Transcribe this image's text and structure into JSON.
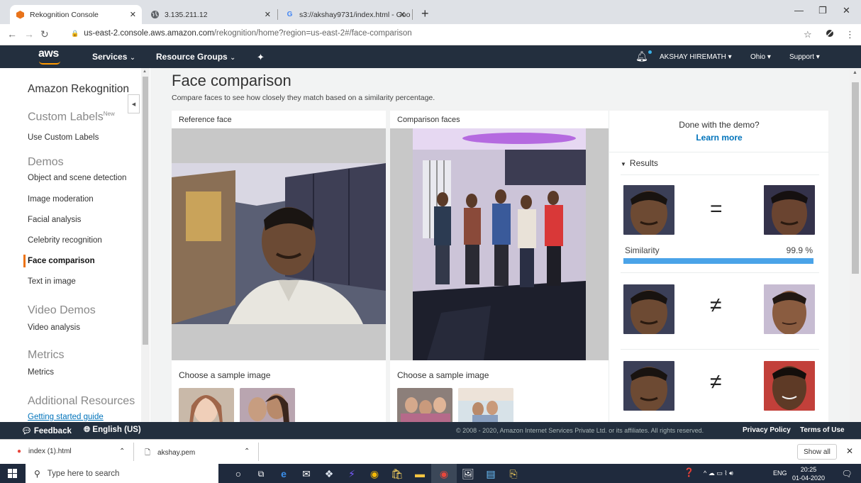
{
  "browser": {
    "tabs": [
      {
        "title": "Rekognition Console",
        "favicon": "aws-cube-icon",
        "active": true
      },
      {
        "title": "3.135.211.12",
        "favicon": "globe-icon",
        "active": false
      },
      {
        "title": "s3://akshay9731/index.html - Goo",
        "favicon": "google-icon",
        "active": false
      }
    ],
    "url_host": "us-east-2.console.aws.amazon.com",
    "url_path": "/rekognition/home?region=us-east-2#/face-comparison"
  },
  "aws_header": {
    "logo": "aws",
    "services": "Services",
    "resource_groups": "Resource Groups",
    "user": "AKSHAY HIREMATH",
    "region": "Ohio",
    "support": "Support"
  },
  "sidebar": {
    "title": "Amazon Rekognition",
    "sections": {
      "custom_labels": "Custom Labels",
      "custom_labels_badge": "New",
      "demos": "Demos",
      "video_demos": "Video Demos",
      "metrics": "Metrics",
      "additional": "Additional Resources"
    },
    "items": {
      "use_custom_labels": "Use Custom Labels",
      "object_scene": "Object and scene detection",
      "image_moderation": "Image moderation",
      "facial_analysis": "Facial analysis",
      "celebrity": "Celebrity recognition",
      "face_comparison": "Face comparison",
      "text_in_image": "Text in image",
      "video_analysis": "Video analysis",
      "metrics": "Metrics",
      "getting_started": "Getting started guide"
    }
  },
  "main": {
    "title": "Face comparison",
    "subtitle": "Compare faces to see how closely they match based on a similarity percentage.",
    "reference_label": "Reference face",
    "comparison_label": "Comparison faces",
    "sample_label_left": "Choose a sample image",
    "sample_label_right": "Choose a sample image"
  },
  "results": {
    "done_text": "Done with the demo?",
    "learn_more": "Learn more",
    "heading": "Results",
    "match_symbol": "=",
    "nomatch_symbol": "≠",
    "similarity_label": "Similarity",
    "similarity_value": "99.9 %",
    "similarity_fraction": 0.999
  },
  "footer": {
    "feedback": "Feedback",
    "language": "English (US)",
    "copyright": "© 2008 - 2020, Amazon Internet Services Private Ltd. or its affiliates. All rights reserved.",
    "privacy": "Privacy Policy",
    "terms": "Terms of Use"
  },
  "downloads": {
    "file1": "index (1).html",
    "file2": "akshay.pem",
    "show_all": "Show all"
  },
  "taskbar": {
    "search_placeholder": "Type here to search",
    "lang": "ENG",
    "time": "20:25",
    "date": "01-04-2020"
  },
  "colors": {
    "aws_dark": "#232f3e",
    "aws_orange": "#ff9900",
    "link_blue": "#0073bb",
    "similarity_bar": "#4aa3e8"
  }
}
